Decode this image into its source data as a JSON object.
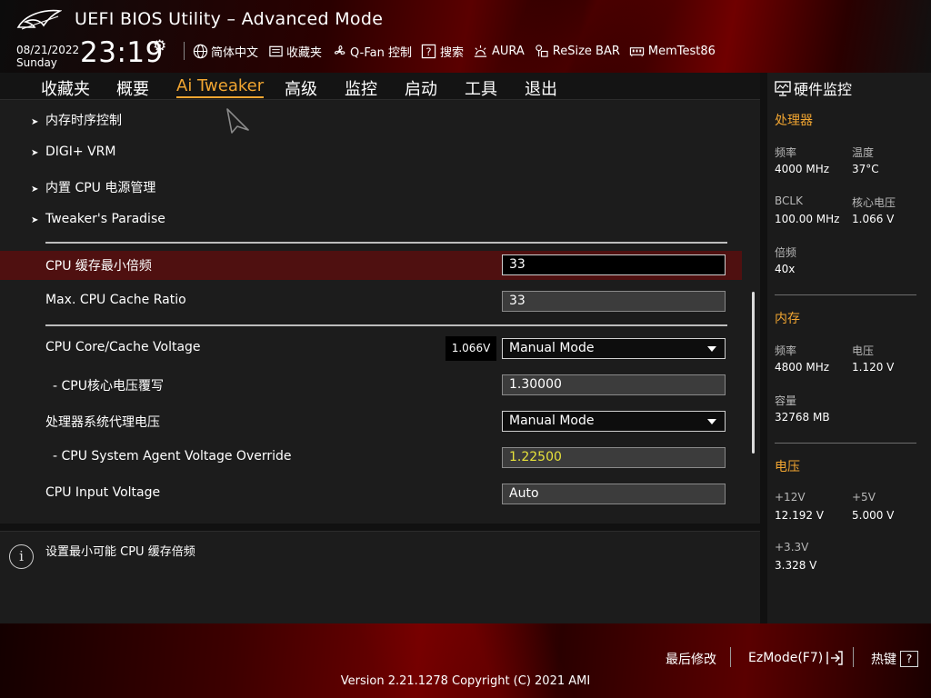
{
  "header": {
    "title": "UEFI BIOS Utility – Advanced Mode",
    "date": "08/21/2022",
    "weekday": "Sunday",
    "time": "23:19",
    "toolbar": [
      {
        "label": "简体中文",
        "icon": "globe-icon"
      },
      {
        "label": "收藏夹",
        "icon": "favorites-icon"
      },
      {
        "label": "Q-Fan 控制",
        "icon": "fan-icon"
      },
      {
        "label": "搜索",
        "icon": "search-help-icon"
      },
      {
        "label": "AURA",
        "icon": "aura-light-icon"
      },
      {
        "label": "ReSize BAR",
        "icon": "resize-bar-icon"
      },
      {
        "label": "MemTest86",
        "icon": "memory-icon"
      }
    ]
  },
  "tabs": [
    "收藏夹",
    "概要",
    "Ai Tweaker",
    "高级",
    "监控",
    "启动",
    "工具",
    "退出"
  ],
  "active_tab": "Ai Tweaker",
  "main": {
    "submenus": [
      "内存时序控制",
      "DIGI+ VRM",
      "内置 CPU 电源管理",
      "Tweaker's Paradise"
    ],
    "rows": [
      {
        "label": "CPU 缓存最小倍频",
        "value": "33"
      },
      {
        "label": "Max. CPU Cache Ratio",
        "value": "33"
      },
      {
        "label": "CPU Core/Cache Voltage",
        "value": "Manual Mode",
        "readout": "1.066V"
      },
      {
        "label": "- CPU核心电压覆写",
        "value": "1.30000"
      },
      {
        "label": "处理器系统代理电压",
        "value": "Manual Mode"
      },
      {
        "label": "- CPU System Agent Voltage Override",
        "value": "1.22500"
      },
      {
        "label": "CPU Input Voltage",
        "value": "Auto"
      }
    ]
  },
  "help": {
    "text": "设置最小可能 CPU 缓存倍频"
  },
  "monitor": {
    "title": "硬件监控",
    "cpu": {
      "heading": "处理器",
      "freq_label": "频率",
      "freq": "4000 MHz",
      "temp_label": "温度",
      "temp": "37°C",
      "bclk_label": "BCLK",
      "bclk": "100.00 MHz",
      "vcore_label": "核心电压",
      "vcore": "1.066 V",
      "ratio_label": "倍频",
      "ratio": "40x"
    },
    "memory": {
      "heading": "内存",
      "freq_label": "频率",
      "freq": "4800 MHz",
      "volt_label": "电压",
      "volt": "1.120 V",
      "cap_label": "容量",
      "capacity": "32768 MB"
    },
    "voltage": {
      "heading": "电压",
      "v12_label": "+12V",
      "v12": "12.192 V",
      "v5_label": "+5V",
      "v5": "5.000 V",
      "v33_label": "+3.3V",
      "v33": "3.328 V"
    }
  },
  "footer": {
    "last_modified": "最后修改",
    "ezmode": "EzMode(F7)",
    "hotkeys": "热键",
    "hotkey_icon_glyph": "?",
    "version": "Version 2.21.1278 Copyright (C) 2021 AMI"
  },
  "colors": {
    "accent": "#f1a531",
    "highlight_row": "#4f1010",
    "override_value": "#e7e23a"
  }
}
